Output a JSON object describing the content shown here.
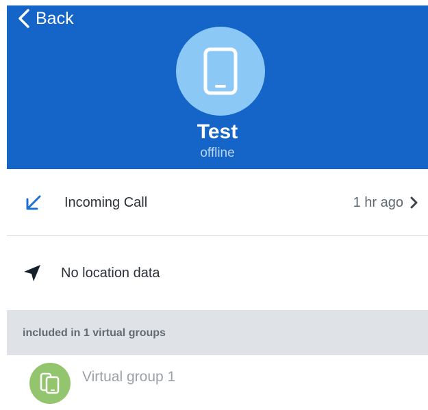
{
  "nav": {
    "back_label": "Back"
  },
  "device": {
    "name": "Test",
    "status": "offline",
    "icon": "phone-icon"
  },
  "recent_activity": {
    "label": "Incoming Call",
    "time": "1 hr ago",
    "icon": "incoming-call-arrow-icon"
  },
  "location": {
    "label": "No location data",
    "icon": "location-arrow-icon"
  },
  "groups_section": {
    "header": "included in 1 virtual groups",
    "items": [
      {
        "label": "Virtual group 1",
        "icon": "multi-device-icon"
      }
    ]
  },
  "colors": {
    "header_bg": "#1565c8",
    "avatar_bg": "#8cc8f6",
    "accent": "#1565c8",
    "group_avatar_bg": "#92c56e",
    "section_bg": "#dfe2e6"
  }
}
